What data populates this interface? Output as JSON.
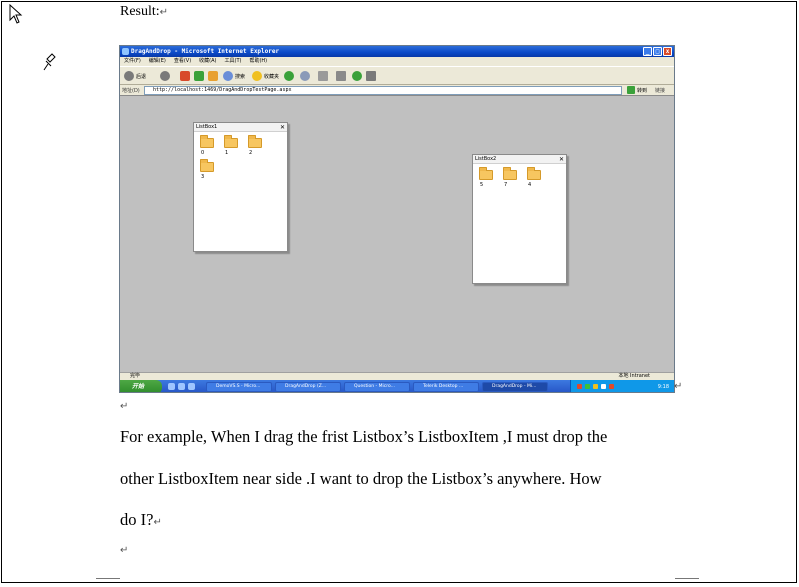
{
  "document": {
    "result_label": "Result:",
    "paragraph_mark": "↵",
    "lines": [
      "For example, When I drag the frist Listbox’s ListboxItem ,I must drop the",
      "other ListboxItem near side .I want to drop the Listbox’s anywhere. How",
      "do I?"
    ]
  },
  "screenshot": {
    "window_title": "DragAndDrop - Microsoft Internet Explorer",
    "menu": [
      "文件(F)",
      "编辑(E)",
      "查看(V)",
      "收藏(A)",
      "工具(T)",
      "帮助(H)"
    ],
    "toolbar": {
      "back": "后退",
      "search": "搜索",
      "favorites": "收藏夹"
    },
    "address_label": "地址(D)",
    "address": "http://localhost:1469/DragAndDropTestPage.aspx",
    "go_label": "转到",
    "links_label": "链接",
    "listbox1": {
      "title": "ListBox1",
      "close": "✕",
      "items": [
        "0",
        "1",
        "2",
        "3"
      ]
    },
    "listbox2": {
      "title": "ListBox2",
      "close": "✕",
      "items": [
        "5",
        "7",
        "4"
      ]
    },
    "status_left": "完毕",
    "status_right": "本地 Intranet",
    "taskbar": {
      "start": "开始",
      "tasks": [
        "DemoVS.S - Micro...",
        "DragAndDrop (Z...",
        "Question - Micro...",
        "Telerik Desktop ...",
        "DragAndDrop - Mi..."
      ],
      "clock": "9:18"
    }
  },
  "colors": {
    "ie_title": "#0a49c8",
    "taskbar": "#2452c4",
    "start": "#2d8a2a",
    "canvas": "#c0c0c0",
    "folder": "#f7c660"
  }
}
